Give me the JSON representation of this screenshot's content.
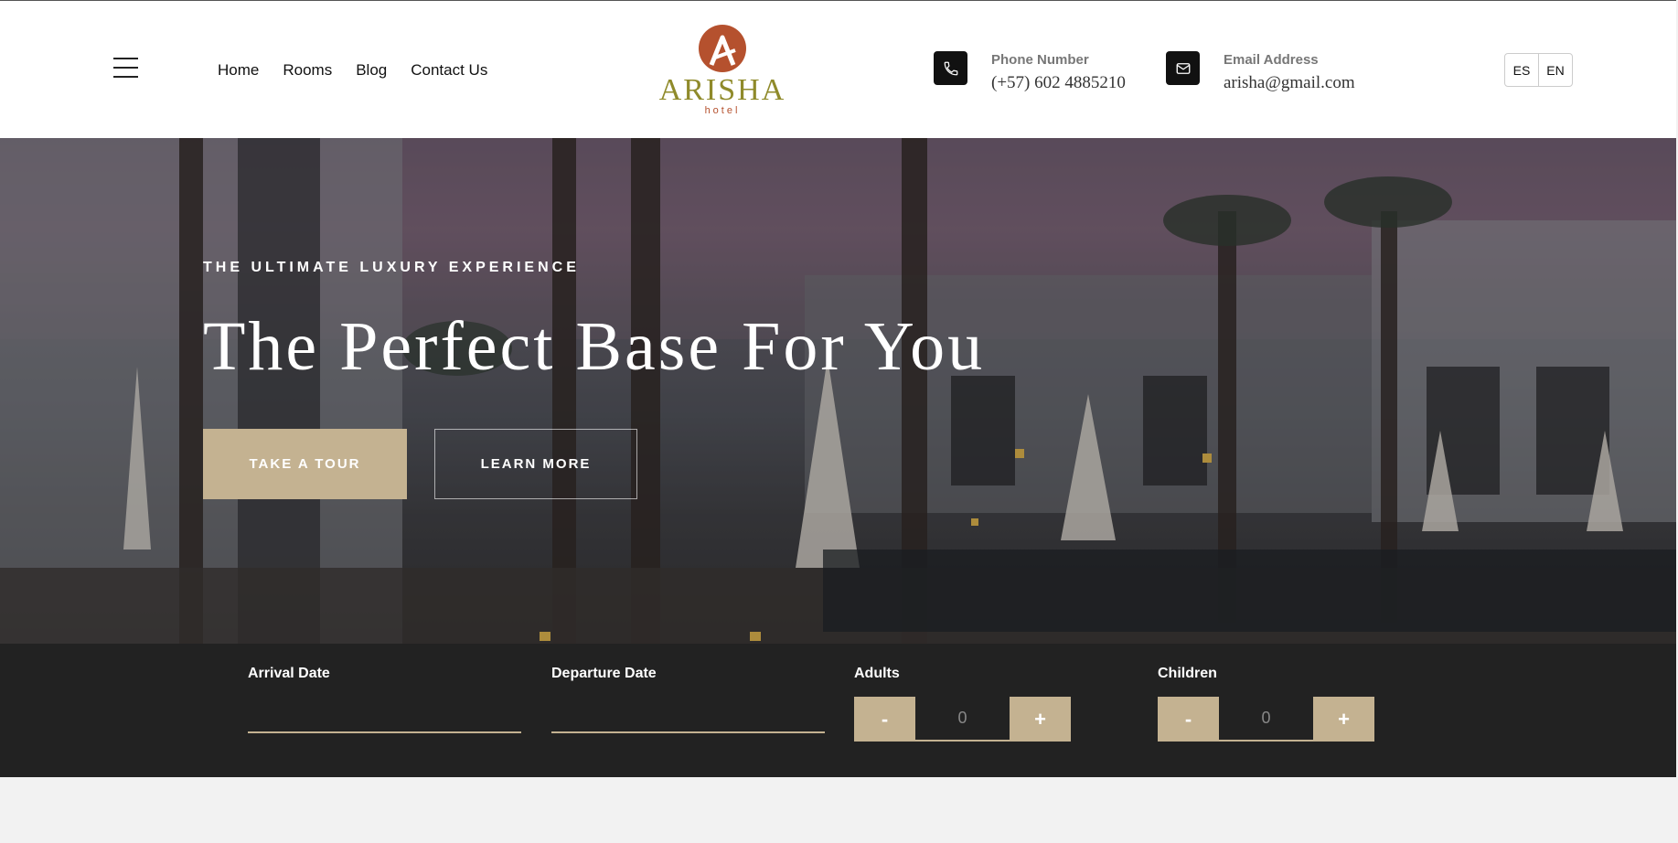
{
  "nav": {
    "items": [
      "Home",
      "Rooms",
      "Blog",
      "Contact Us"
    ]
  },
  "logo": {
    "name": "ARISHA",
    "sub": "hotel",
    "colors": {
      "mark": "#b5512e",
      "text": "#8f8a2a"
    }
  },
  "contact": {
    "phone_label": "Phone Number",
    "phone_value": "(+57) 602 4885210",
    "email_label": "Email Address",
    "email_value": "arisha@gmail.com"
  },
  "languages": [
    "ES",
    "EN"
  ],
  "hero": {
    "kicker": "THE ULTIMATE LUXURY EXPERIENCE",
    "title": "The Perfect Base For You",
    "primary_button": "TAKE A TOUR",
    "secondary_button": "LEARN MORE"
  },
  "booking": {
    "arrival_label": "Arrival Date",
    "arrival_value": "",
    "departure_label": "Departure Date",
    "departure_value": "",
    "adults_label": "Adults",
    "adults_value": "0",
    "children_label": "Children",
    "children_value": "0",
    "minus": "-",
    "plus": "+"
  },
  "colors": {
    "accent": "#c4b291",
    "dark": "#222222",
    "icon_bg": "#111111"
  },
  "icons": [
    "menu-icon",
    "phone-icon",
    "envelope-icon"
  ]
}
